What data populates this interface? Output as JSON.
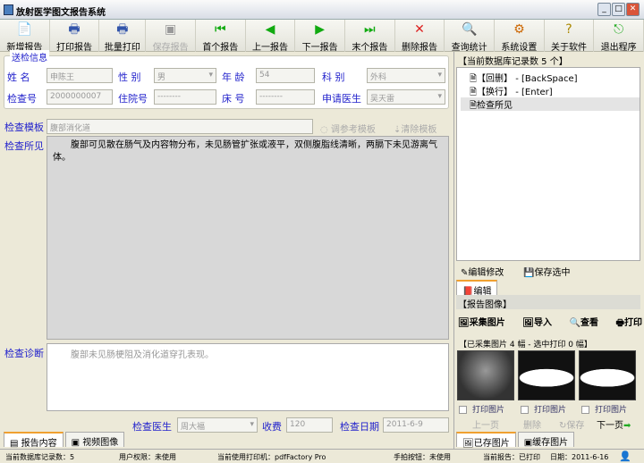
{
  "window": {
    "title": "放射医学图文报告系统"
  },
  "toolbar": [
    {
      "label": "新增报告",
      "icon": "new-report-icon",
      "glyph": "📄",
      "enabled": true
    },
    {
      "label": "打印报告",
      "icon": "printer-icon",
      "glyph": "🖶",
      "enabled": true
    },
    {
      "label": "批量打印",
      "icon": "printer-icon",
      "glyph": "🖶",
      "enabled": true
    },
    {
      "label": "保存报告",
      "icon": "save-icon",
      "glyph": "▣",
      "enabled": false
    },
    {
      "label": "首个报告",
      "icon": "first-icon",
      "glyph": "⏮",
      "enabled": true
    },
    {
      "label": "上一报告",
      "icon": "prev-icon",
      "glyph": "◀",
      "enabled": true
    },
    {
      "label": "下一报告",
      "icon": "next-icon",
      "glyph": "▶",
      "enabled": true
    },
    {
      "label": "末个报告",
      "icon": "last-icon",
      "glyph": "⏭",
      "enabled": true
    },
    {
      "label": "删除报告",
      "icon": "delete-icon",
      "glyph": "✕",
      "enabled": true
    },
    {
      "label": "查询统计",
      "icon": "query-icon",
      "glyph": "🔍",
      "enabled": true
    },
    {
      "label": "系统设置",
      "icon": "settings-icon",
      "glyph": "⚙",
      "enabled": true
    },
    {
      "label": "关于软件",
      "icon": "help-icon",
      "glyph": "?",
      "enabled": true
    },
    {
      "label": "退出程序",
      "icon": "exit-icon",
      "glyph": "⎋",
      "enabled": true
    }
  ],
  "patient": {
    "group_title": "送检信息",
    "name_label": "姓  名",
    "name": "申陈王",
    "sex_label": "性  别",
    "sex": "男",
    "age_label": "年  龄",
    "age": "54",
    "dept_label": "科    别",
    "dept": "外科",
    "exam_no_label": "检查号",
    "exam_no": "2000000007",
    "inpatient_label": "住院号",
    "inpatient": "--------",
    "bed_label": "床  号",
    "bed": "--------",
    "req_doctor_label": "申请医生",
    "req_doctor": "吴天雷"
  },
  "template": {
    "label": "检查模板",
    "value": "腹部消化道",
    "ref_btn": "调参考模板",
    "clear_btn": "清除模板"
  },
  "findings": {
    "label": "检查所见",
    "text": "腹部可见散在肠气及内容物分布，未见肠管扩张或液平，双侧腹脂线清晰，两膈下未见游离气体。"
  },
  "diagnosis": {
    "label": "检查诊断",
    "text": "腹部未见肠梗阻及消化道穿孔表现。"
  },
  "footer": {
    "doctor_label": "检查医生",
    "doctor": "周大福",
    "fee_label": "收费",
    "fee": "120",
    "date_label": "检查日期",
    "date": "2011-6-9"
  },
  "left_tabs": [
    "报告内容",
    "视频图像"
  ],
  "right": {
    "db_header": "【当前数据库记录数 5 个】",
    "tree": [
      "【回删】 - [BackSpace]",
      "【换行】 - [Enter]",
      "检查所见"
    ],
    "edit_btn": "编辑修改",
    "save_sel_btn": "保存选中",
    "edit_tab": "编辑",
    "images_header": "【报告图像】",
    "img_tools": [
      "采集图片",
      "导入",
      "查看",
      "打印"
    ],
    "collected": "【已采集图片 4 幅 - 选中打印 0 幅】",
    "print_img": "打印图片",
    "nav": {
      "prev": "上一页",
      "delete": "删除",
      "save": "保存",
      "next": "下一页"
    },
    "tabs": [
      "已存图片",
      "缓存图片"
    ]
  },
  "status": {
    "records": "当前数据库记录数：5",
    "user": "用户权限：未使用",
    "printer": "当前使用打印机：pdfFactory Pro",
    "hand": "手拍按钮：未使用",
    "report": "当前报告：已打印",
    "date": "日期：2011-6-16"
  }
}
